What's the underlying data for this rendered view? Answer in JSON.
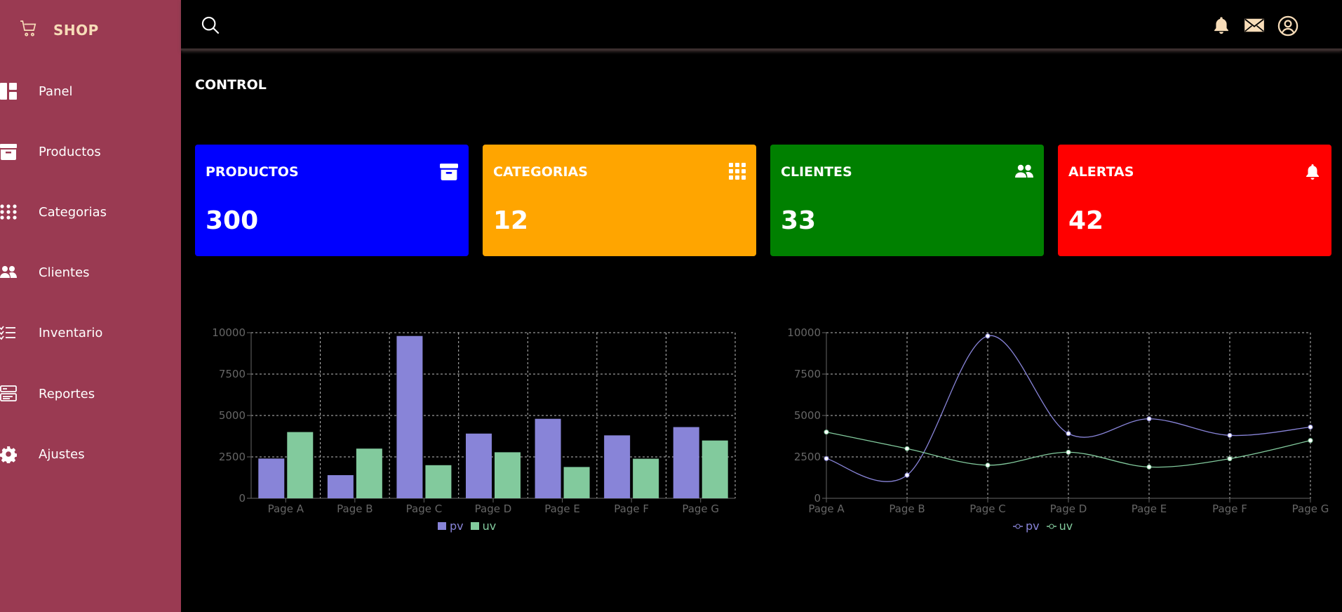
{
  "brand": {
    "title": "SHOP"
  },
  "sidebar": {
    "items": [
      {
        "label": "Panel",
        "icon": "dashboard-icon"
      },
      {
        "label": "Productos",
        "icon": "archive-icon"
      },
      {
        "label": "Categorias",
        "icon": "grid-icon"
      },
      {
        "label": "Clientes",
        "icon": "people-icon"
      },
      {
        "label": "Inventario",
        "icon": "checklist-icon"
      },
      {
        "label": "Reportes",
        "icon": "reports-icon"
      },
      {
        "label": "Ajustes",
        "icon": "gear-icon"
      }
    ]
  },
  "header": {
    "icons": [
      "search-icon",
      "bell-icon",
      "mail-icon",
      "user-circle-icon"
    ]
  },
  "main": {
    "title": "CONTROL",
    "cards": [
      {
        "title": "PRODUCTOS",
        "value": "300",
        "color": "#0000ff",
        "icon": "archive-icon"
      },
      {
        "title": "CATEGORIAS",
        "value": "12",
        "color": "#ffa500",
        "icon": "grid-icon"
      },
      {
        "title": "CLIENTES",
        "value": "33",
        "color": "#008000",
        "icon": "people-icon"
      },
      {
        "title": "ALERTAS",
        "value": "42",
        "color": "#ff0000",
        "icon": "bell-icon"
      }
    ]
  },
  "colors": {
    "sidebar": "#9a3a52",
    "brand": "#f7dcb8",
    "pv": "#8884d8",
    "uv": "#82ca9d",
    "axis": "#666666"
  },
  "chart_data": [
    {
      "type": "bar",
      "categories": [
        "Page A",
        "Page B",
        "Page C",
        "Page D",
        "Page E",
        "Page F",
        "Page G"
      ],
      "series": [
        {
          "name": "pv",
          "values": [
            2400,
            1398,
            9800,
            3908,
            4800,
            3800,
            4300
          ]
        },
        {
          "name": "uv",
          "values": [
            4000,
            3000,
            2000,
            2780,
            1890,
            2390,
            3490
          ]
        }
      ],
      "yticks": [
        "0",
        "2500",
        "5000",
        "7500",
        "10000"
      ],
      "ylim": [
        0,
        10000
      ],
      "grid": true,
      "legend": "bottom"
    },
    {
      "type": "line",
      "categories": [
        "Page A",
        "Page B",
        "Page C",
        "Page D",
        "Page E",
        "Page F",
        "Page G"
      ],
      "series": [
        {
          "name": "pv",
          "values": [
            2400,
            1398,
            9800,
            3908,
            4800,
            3800,
            4300
          ]
        },
        {
          "name": "uv",
          "values": [
            4000,
            3000,
            2000,
            2780,
            1890,
            2390,
            3490
          ]
        }
      ],
      "yticks": [
        "0",
        "2500",
        "5000",
        "7500",
        "10000"
      ],
      "ylim": [
        0,
        10000
      ],
      "grid": true,
      "legend": "bottom"
    }
  ]
}
